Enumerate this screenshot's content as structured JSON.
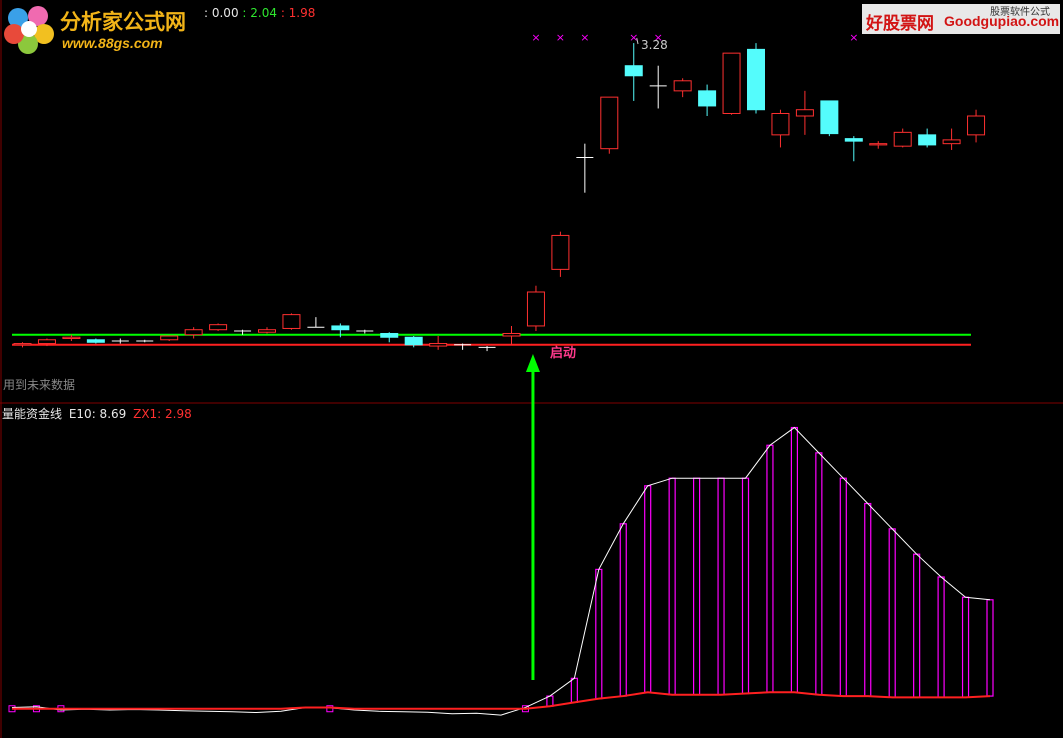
{
  "top_panel": {
    "header_values": [
      {
        "text": ": 0.00",
        "color": "#e8e8e8"
      },
      {
        "text": ": 2.04",
        "color": "#2ee62e"
      },
      {
        "text": ": 1.98",
        "color": "#ff3030"
      }
    ],
    "status_text": "用到未来数据",
    "signal_label": "启动",
    "high_label": "3.28",
    "support_level_green": 0.96,
    "support_level_red": 0.88
  },
  "bottom_panel": {
    "indicator_name": "量能资金线",
    "e10_label": "E10: 8.69",
    "zx1_label": "ZX1: 2.98"
  },
  "logos": {
    "left_brand": "分析家公式网",
    "left_url": "www.88gs.com",
    "right_brand_cn": "好股票网",
    "right_brand_en": "Goodgupiao.com",
    "right_sub": "股票软件公式"
  },
  "colors": {
    "up": "#ff3030",
    "down": "#54fcfc",
    "doji": "#ffffff",
    "green_line": "#00ff00",
    "red_line": "#ff2020",
    "magenta_bar": "#ff00ff",
    "signal_arrow": "#00ff00",
    "divider": "#800000",
    "marker": "#ff00ff"
  },
  "chart_data": [
    {
      "type": "candlestick",
      "y_range": [
        0.6,
        3.4
      ],
      "ohlc": [
        [
          0.88,
          0.9,
          0.86,
          0.89
        ],
        [
          0.89,
          0.93,
          0.87,
          0.92
        ],
        [
          0.93,
          0.96,
          0.91,
          0.94
        ],
        [
          0.92,
          0.93,
          0.89,
          0.9
        ],
        [
          0.91,
          0.93,
          0.89,
          0.91
        ],
        [
          0.91,
          0.92,
          0.9,
          0.91
        ],
        [
          0.92,
          0.95,
          0.91,
          0.95
        ],
        [
          0.96,
          1.02,
          0.93,
          1.0
        ],
        [
          1.0,
          1.05,
          0.99,
          1.04
        ],
        [
          0.99,
          1.0,
          0.96,
          0.99
        ],
        [
          0.98,
          1.02,
          0.97,
          1.0
        ],
        [
          1.01,
          1.13,
          1.0,
          1.12
        ],
        [
          1.02,
          1.1,
          1.02,
          1.02
        ],
        [
          1.03,
          1.05,
          0.94,
          1.0
        ],
        [
          0.99,
          1.0,
          0.97,
          0.99
        ],
        [
          0.97,
          0.98,
          0.9,
          0.94
        ],
        [
          0.94,
          0.95,
          0.86,
          0.88
        ],
        [
          0.87,
          0.95,
          0.84,
          0.89
        ],
        [
          0.88,
          0.89,
          0.84,
          0.88
        ],
        [
          0.86,
          0.87,
          0.83,
          0.86
        ],
        [
          0.95,
          1.03,
          0.88,
          0.97
        ],
        [
          1.03,
          1.35,
          0.99,
          1.3
        ],
        [
          1.48,
          1.78,
          1.42,
          1.75
        ],
        [
          2.37,
          2.48,
          2.09,
          2.37
        ],
        [
          2.44,
          2.85,
          2.4,
          2.85
        ],
        [
          3.1,
          3.28,
          2.82,
          3.02
        ],
        [
          2.94,
          3.1,
          2.76,
          2.94
        ],
        [
          2.9,
          3.0,
          2.85,
          2.98
        ],
        [
          2.9,
          2.95,
          2.7,
          2.78
        ],
        [
          2.72,
          3.2,
          2.71,
          3.2
        ],
        [
          3.23,
          3.28,
          2.72,
          2.75
        ],
        [
          2.55,
          2.75,
          2.45,
          2.72
        ],
        [
          2.7,
          2.9,
          2.55,
          2.75
        ],
        [
          2.82,
          2.82,
          2.54,
          2.56
        ],
        [
          2.52,
          2.54,
          2.34,
          2.5
        ],
        [
          2.47,
          2.5,
          2.44,
          2.48
        ],
        [
          2.46,
          2.6,
          2.45,
          2.57
        ],
        [
          2.55,
          2.6,
          2.45,
          2.47
        ],
        [
          2.48,
          2.6,
          2.43,
          2.51
        ],
        [
          2.55,
          2.75,
          2.49,
          2.7
        ]
      ],
      "markers_at": [
        21,
        22,
        23,
        25,
        26,
        34
      ]
    },
    {
      "type": "bar_line",
      "y_range": [
        -8,
        112
      ],
      "bars": [
        0,
        0,
        0,
        0,
        0,
        0,
        0,
        0,
        0,
        0,
        0,
        0,
        0,
        0,
        0,
        0,
        0,
        0,
        0,
        0,
        0,
        0,
        5,
        12,
        55,
        73,
        88,
        91,
        91,
        91,
        91,
        104,
        111,
        101,
        91,
        81,
        71,
        61,
        52,
        44,
        43
      ],
      "line_white": [
        0.5,
        0.8,
        -0.5,
        -0.2,
        -0.5,
        -0.3,
        -0.5,
        -0.8,
        -1.0,
        -1.2,
        -1.5,
        -1.0,
        0.5,
        0.4,
        -0.5,
        -1.0,
        -1.2,
        -1.4,
        -2.0,
        -1.8,
        -2.5,
        0.5,
        5,
        12,
        55,
        73,
        88,
        91,
        91,
        91,
        91,
        104,
        111,
        101,
        91,
        81,
        71,
        61,
        52,
        44,
        43
      ],
      "line_red": [
        0,
        0,
        0,
        0,
        0,
        0,
        0,
        0,
        0,
        0,
        0,
        0,
        0.5,
        0.5,
        0,
        0,
        0,
        0,
        0,
        0,
        0,
        0,
        1,
        2.5,
        4,
        5,
        6.5,
        5.5,
        5.5,
        5.5,
        6,
        6.5,
        6.5,
        5.5,
        5,
        5,
        4.5,
        4.5,
        4.5,
        4.5,
        5
      ]
    }
  ]
}
